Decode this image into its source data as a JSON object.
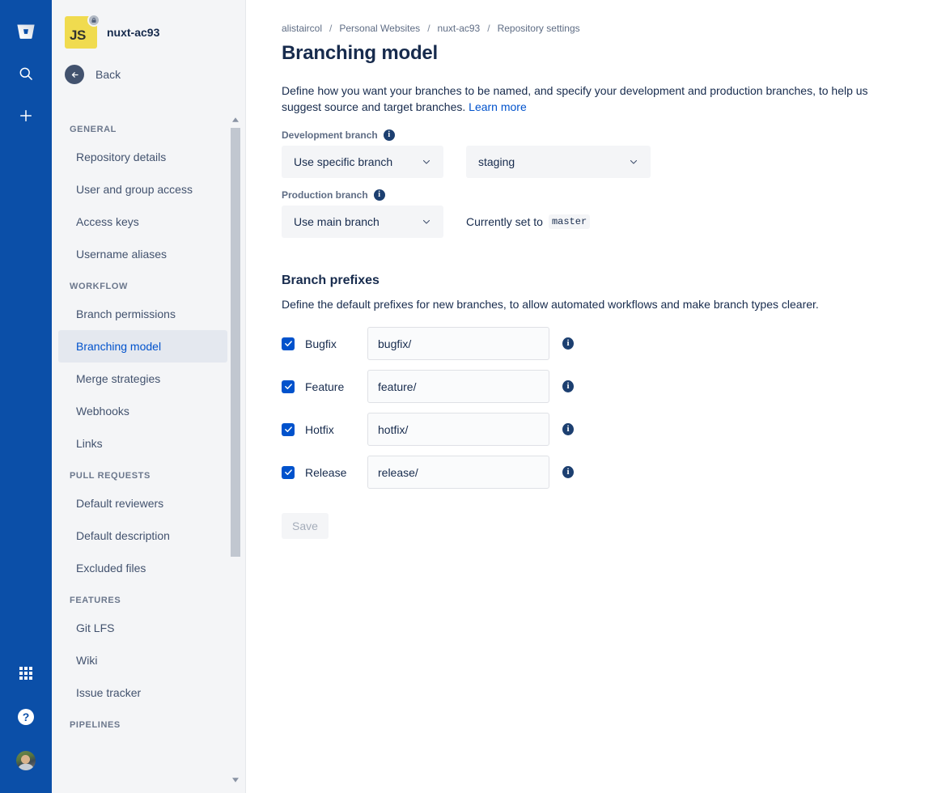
{
  "rail": {
    "logo_icon": "bitbucket-logo",
    "search_icon": "search-icon",
    "create_icon": "plus-icon",
    "apps_icon": "app-switcher-icon",
    "help_icon": "help-icon",
    "help_glyph": "?",
    "avatar_icon": "user-avatar"
  },
  "sidebar": {
    "repo": {
      "avatar_text": "JS",
      "name": "nuxt-ac93",
      "lock_icon": "lock-icon"
    },
    "back": {
      "label": "Back",
      "icon": "arrow-left-icon"
    },
    "groups": [
      {
        "title": "GENERAL",
        "items": [
          {
            "label": "Repository details",
            "selected": false
          },
          {
            "label": "User and group access",
            "selected": false
          },
          {
            "label": "Access keys",
            "selected": false
          },
          {
            "label": "Username aliases",
            "selected": false
          }
        ]
      },
      {
        "title": "WORKFLOW",
        "items": [
          {
            "label": "Branch permissions",
            "selected": false
          },
          {
            "label": "Branching model",
            "selected": true
          },
          {
            "label": "Merge strategies",
            "selected": false
          },
          {
            "label": "Webhooks",
            "selected": false
          },
          {
            "label": "Links",
            "selected": false
          }
        ]
      },
      {
        "title": "PULL REQUESTS",
        "items": [
          {
            "label": "Default reviewers",
            "selected": false
          },
          {
            "label": "Default description",
            "selected": false
          },
          {
            "label": "Excluded files",
            "selected": false
          }
        ]
      },
      {
        "title": "FEATURES",
        "items": [
          {
            "label": "Git LFS",
            "selected": false
          },
          {
            "label": "Wiki",
            "selected": false
          },
          {
            "label": "Issue tracker",
            "selected": false
          }
        ]
      },
      {
        "title": "PIPELINES",
        "items": []
      }
    ]
  },
  "main": {
    "breadcrumb": [
      {
        "label": "alistaircol"
      },
      {
        "label": "Personal Websites"
      },
      {
        "label": "nuxt-ac93"
      },
      {
        "label": "Repository settings"
      }
    ],
    "breadcrumb_separator": "/",
    "title": "Branching model",
    "intro_text": "Define how you want your branches to be named, and specify your development and production branches, to help us suggest source and target branches.",
    "intro_link": "Learn more",
    "development_branch": {
      "label": "Development branch",
      "info_icon": "info-icon",
      "mode_value": "Use specific branch",
      "branch_value": "staging",
      "chevron_icon": "chevron-down-icon"
    },
    "production_branch": {
      "label": "Production branch",
      "info_icon": "info-icon",
      "mode_value": "Use main branch",
      "currently_prefix": "Currently set to",
      "currently_value": "master",
      "chevron_icon": "chevron-down-icon"
    },
    "prefixes_section": {
      "title": "Branch prefixes",
      "description": "Define the default prefixes for new branches, to allow automated workflows and make branch types clearer.",
      "rows": [
        {
          "label": "Bugfix",
          "value": "bugfix/",
          "checked": true,
          "info_icon": "info-icon"
        },
        {
          "label": "Feature",
          "value": "feature/",
          "checked": true,
          "info_icon": "info-icon"
        },
        {
          "label": "Hotfix",
          "value": "hotfix/",
          "checked": true,
          "info_icon": "info-icon"
        },
        {
          "label": "Release",
          "value": "release/",
          "checked": true,
          "info_icon": "info-icon"
        }
      ],
      "save_label": "Save"
    }
  },
  "colors": {
    "rail_blue": "#0b4fa8",
    "accent_blue": "#0052cc",
    "text_dark": "#172b4d",
    "text_muted": "#5e6c84",
    "sidebar_bg": "#f4f5f7",
    "js_yellow": "#f0db4f"
  }
}
